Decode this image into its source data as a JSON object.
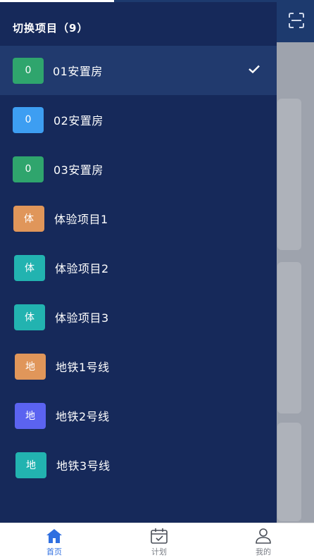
{
  "drawer": {
    "title": "切换项目（9）",
    "projects": [
      {
        "badge": "0",
        "name": "01安置房",
        "color": "#2fa56d",
        "selected": true
      },
      {
        "badge": "0",
        "name": "02安置房",
        "color": "#3d9ef2",
        "selected": false
      },
      {
        "badge": "0",
        "name": "03安置房",
        "color": "#2fa56d",
        "selected": false
      },
      {
        "badge": "体",
        "name": "体验项目1",
        "color": "#e0965a",
        "selected": false
      },
      {
        "badge": "体",
        "name": "体验项目2",
        "color": "#22b3b0",
        "selected": false
      },
      {
        "badge": "体",
        "name": "体验项目3",
        "color": "#22b3b0",
        "selected": false
      },
      {
        "badge": "地",
        "name": "地铁1号线",
        "color": "#e0965a",
        "selected": false
      },
      {
        "badge": "地",
        "name": "地铁2号线",
        "color": "#5b63f0",
        "selected": false
      },
      {
        "badge": "地",
        "name": "地铁3号线",
        "color": "#22b3b0",
        "selected": false
      }
    ]
  },
  "header": {
    "scan_icon": "scan-icon"
  },
  "bottom_nav": {
    "items": [
      {
        "label": "首页",
        "icon": "home-icon",
        "active": true
      },
      {
        "label": "计划",
        "icon": "calendar-icon",
        "active": false
      },
      {
        "label": "我的",
        "icon": "user-icon",
        "active": false
      }
    ]
  },
  "colors": {
    "drawer_bg": "#16295a",
    "selected_row": "#213a6e",
    "header_bg": "#1d3a6e",
    "nav_active": "#2f6fe0",
    "nav_inactive": "#7b7f87"
  }
}
